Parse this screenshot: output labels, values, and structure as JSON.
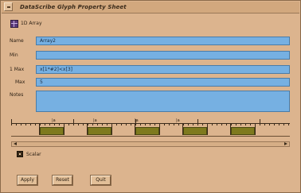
{
  "window": {
    "title": "DataScribe Glyph Property Sheet"
  },
  "header": {
    "icon": "grid-icon",
    "label": "1D Array"
  },
  "fields": [
    {
      "label": "Name",
      "value": "Array2"
    },
    {
      "label": "Min",
      "value": ""
    },
    {
      "label": "1 Max",
      "value": "x[1*#2]<x[3]"
    },
    {
      "label": "Max",
      "value": "5"
    },
    {
      "label": "Notes",
      "value": ""
    }
  ],
  "ruler": {
    "labels": [
      "|a",
      "|a",
      "|a",
      "|a"
    ],
    "segments": 5
  },
  "scalar": {
    "label": "Scalar",
    "checked": true
  },
  "buttons": {
    "apply": "Apply",
    "reset": "Reset",
    "quit": "Quit"
  },
  "colors": {
    "background": "#dcb48e",
    "field": "#76b0e2",
    "segment": "#7e7a1e"
  }
}
